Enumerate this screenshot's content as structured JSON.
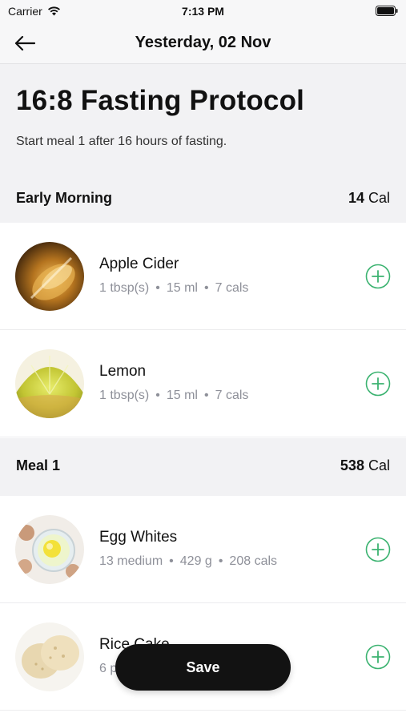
{
  "status_bar": {
    "carrier": "Carrier",
    "time": "7:13 PM"
  },
  "nav": {
    "title": "Yesterday, 02 Nov",
    "back_icon": "arrow-left-icon"
  },
  "header": {
    "title": "16:8 Fasting Protocol",
    "subtitle": "Start meal 1 after 16 hours of fasting."
  },
  "sections": [
    {
      "name": "Early Morning",
      "cal_value": "14",
      "cal_unit": "Cal",
      "items": [
        {
          "name": "Apple Cider",
          "qty": "1 tbsp(s)",
          "weight": "15 ml",
          "cals": "7 cals"
        },
        {
          "name": "Lemon",
          "qty": "1 tbsp(s)",
          "weight": "15 ml",
          "cals": "7 cals"
        }
      ]
    },
    {
      "name": "Meal 1",
      "cal_value": "538",
      "cal_unit": "Cal",
      "items": [
        {
          "name": "Egg Whites",
          "qty": "13 medium",
          "weight": "429 g",
          "cals": "208 cals"
        },
        {
          "name": "Rice Cake",
          "qty": "6 p"
        }
      ]
    }
  ],
  "dot_separator": "•",
  "save_label": "Save",
  "colors": {
    "accent_green": "#3cb371",
    "save_bg": "#121212",
    "section_bg": "#f2f2f4"
  }
}
